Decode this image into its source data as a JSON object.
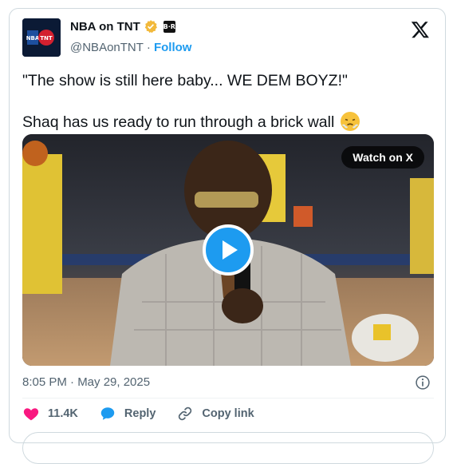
{
  "author": {
    "name": "NBA on TNT",
    "handle": "@NBAonTNT",
    "follow_label": "Follow",
    "separator": "·",
    "badge_text": "B·R",
    "verified_color": "#f2b93b"
  },
  "tweet": {
    "line1": "\"The show is still here baby... WE DEM BOYZ!\"",
    "line2": "Shaq has us ready to run through a brick wall",
    "emoji": "face-with-steam-from-nose"
  },
  "media": {
    "watch_label": "Watch on X",
    "play_icon": "play-icon"
  },
  "meta": {
    "timestamp": "8:05 PM · May 29, 2025"
  },
  "actions": {
    "likes": "11.4K",
    "reply_label": "Reply",
    "copy_label": "Copy link"
  },
  "colors": {
    "accent": "#1d9bf0",
    "like": "#f91880",
    "muted": "#536471"
  }
}
